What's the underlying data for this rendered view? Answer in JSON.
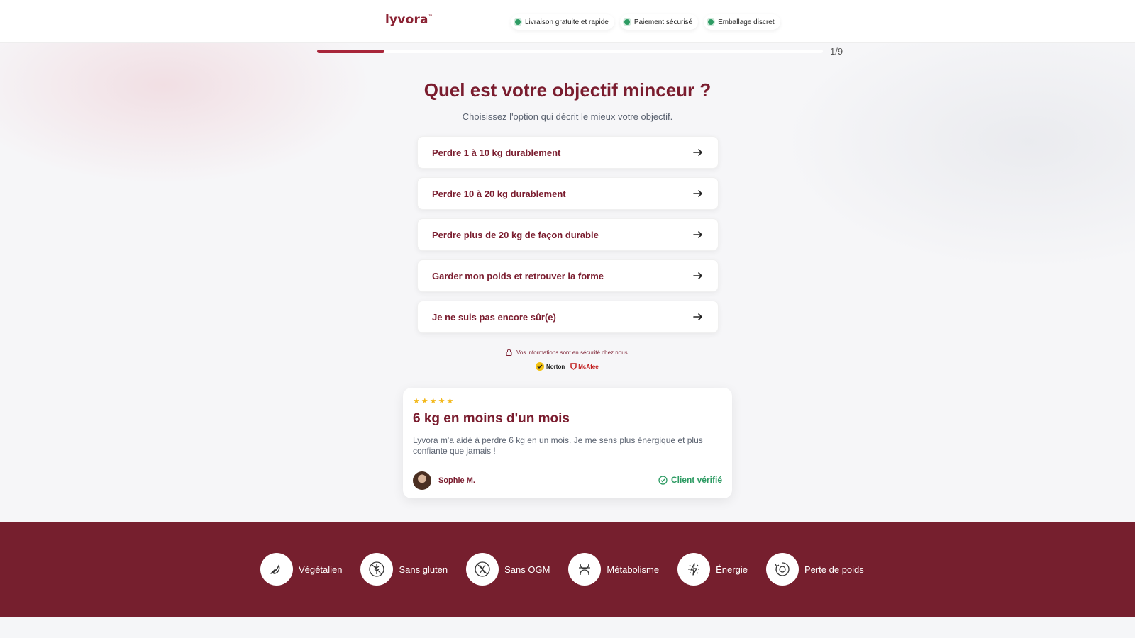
{
  "header": {
    "logo": "lyvora",
    "logo_tm": "™",
    "badges": [
      {
        "label": "Livraison gratuite et rapide"
      },
      {
        "label": "Paiement sécurisé"
      },
      {
        "label": "Emballage discret"
      }
    ]
  },
  "progress": {
    "fraction": 0.1111,
    "label": "1/9"
  },
  "question": {
    "title": "Quel est votre objectif minceur ?",
    "subtitle": "Choisissez l'option qui décrit le mieux votre objectif."
  },
  "options": [
    {
      "label": "Perdre 1 à 10 kg durablement"
    },
    {
      "label": "Perdre 10 à 20 kg durablement"
    },
    {
      "label": "Perdre plus de 20 kg de façon durable"
    },
    {
      "label": "Garder mon poids et retrouver la forme"
    },
    {
      "label": "Je ne suis pas encore sûr(e)"
    }
  ],
  "security": {
    "text": "Vos informations sont en sécurité chez nous.",
    "norton": "Norton",
    "mcafee": "McAfee"
  },
  "review": {
    "stars": "★★★★★",
    "rating": 5,
    "title": "6 kg en moins d'un mois",
    "text": "Lyvora m'a aidé à perdre 6 kg en un mois. Je me sens plus énergique et plus confiante que jamais !",
    "author": "Sophie M.",
    "verified": "Client vérifié"
  },
  "features": [
    {
      "label": "Végétalien",
      "icon": "leaf-icon"
    },
    {
      "label": "Sans gluten",
      "icon": "gluten-free-icon"
    },
    {
      "label": "Sans OGM",
      "icon": "non-gmo-icon"
    },
    {
      "label": "Métabolisme",
      "icon": "metabolism-icon"
    },
    {
      "label": "Énergie",
      "icon": "energy-icon"
    },
    {
      "label": "Perte de poids",
      "icon": "weight-loss-icon"
    }
  ],
  "colors": {
    "brand": "#7a1c2e",
    "footer": "#761f2e",
    "progress": "#a8263a",
    "verified": "#2d9b63",
    "stars": "#f3b81a"
  }
}
